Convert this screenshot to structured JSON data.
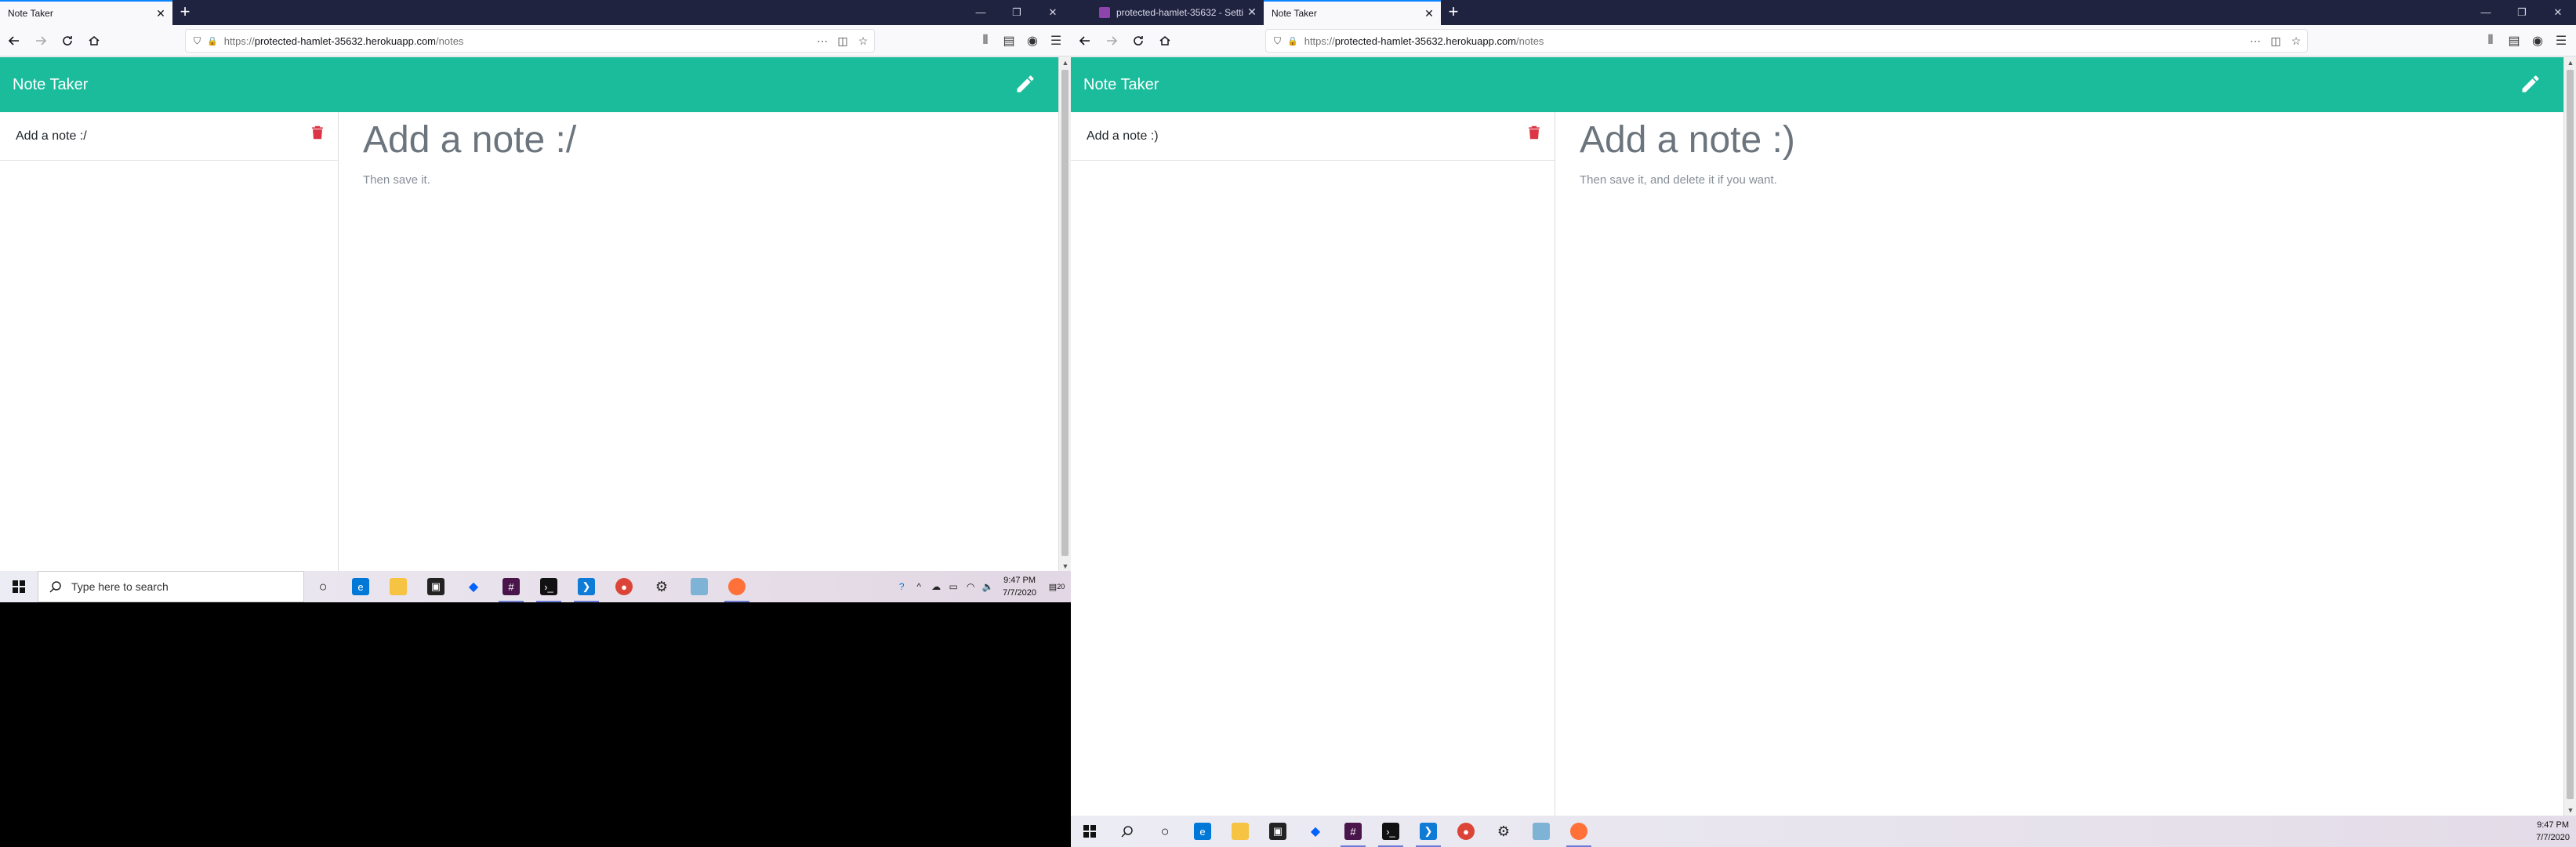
{
  "left_screen": {
    "tabs": [
      {
        "label": "Note Taker",
        "active": true
      }
    ],
    "window_controls": [
      "—",
      "❐",
      "✕"
    ],
    "url": {
      "scheme": "https://",
      "host": "protected-hamlet-35632.herokuapp.com",
      "path": "/notes"
    },
    "app": {
      "title": "Note Taker",
      "notes": [
        {
          "title": "Add a note :/"
        }
      ],
      "editor_title": "Add a note :/",
      "editor_text": "Then save it."
    },
    "taskbar": {
      "search_placeholder": "Type here to search",
      "time": "9:47 PM",
      "date": "7/7/2020",
      "notification_count": "20"
    }
  },
  "right_screen": {
    "tabs": [
      {
        "label": "protected-hamlet-35632 - Setti",
        "active": false
      },
      {
        "label": "Note Taker",
        "active": true
      }
    ],
    "window_controls": [
      "—",
      "❐",
      "✕"
    ],
    "url": {
      "scheme": "https://",
      "host": "protected-hamlet-35632.herokuapp.com",
      "path": "/notes"
    },
    "app": {
      "title": "Note Taker",
      "notes": [
        {
          "title": "Add a note :)"
        }
      ],
      "editor_title": "Add a note :)",
      "editor_text": "Then save it, and delete it if you want."
    },
    "taskbar": {
      "time": "9:47 PM",
      "date": "7/7/2020"
    }
  },
  "colors": {
    "header": "#1abc9c",
    "trash": "#dc3545",
    "tabstrip": "#202340",
    "focus_accent": "#0a84ff"
  },
  "icons": [
    "back-icon",
    "forward-icon",
    "reload-icon",
    "home-icon",
    "shield-icon",
    "lock-icon",
    "more-icon",
    "pocket-icon",
    "star-icon",
    "library-icon",
    "sidebar-icon",
    "account-icon",
    "menu-icon",
    "pencil-icon",
    "trash-icon",
    "windows-icon",
    "search-icon",
    "cortana-icon",
    "edge-icon",
    "file-explorer-icon",
    "store-icon",
    "dropbox-icon",
    "slack-icon",
    "terminal-icon",
    "vscode-icon",
    "chrome-icon",
    "settings-icon",
    "files-icon",
    "firefox-icon"
  ]
}
